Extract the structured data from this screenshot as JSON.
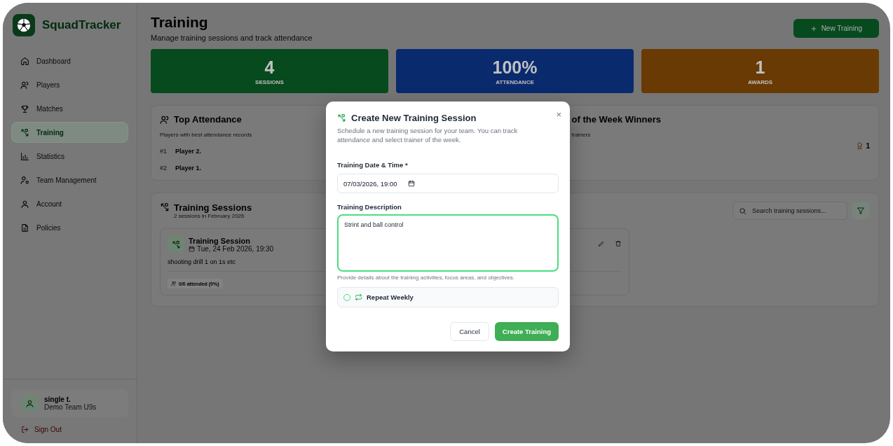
{
  "brand": {
    "name": "SquadTracker"
  },
  "nav": [
    {
      "label": "Dashboard",
      "selected": false
    },
    {
      "label": "Players",
      "selected": false
    },
    {
      "label": "Matches",
      "selected": false
    },
    {
      "label": "Training",
      "selected": true
    },
    {
      "label": "Statistics",
      "selected": false
    },
    {
      "label": "Team Management",
      "selected": false
    },
    {
      "label": "Account",
      "selected": false
    },
    {
      "label": "Policies",
      "selected": false
    }
  ],
  "user": {
    "name": "single t.",
    "team": "Demo Team U9s"
  },
  "sign_out": "Sign Out",
  "page": {
    "title": "Training",
    "subtitle": "Manage training sessions and track attendance",
    "new_button": "New Training"
  },
  "stats": [
    {
      "value": "4",
      "label": "SESSIONS",
      "color": "#064a1e"
    },
    {
      "value": "100%",
      "label": "ATTENDANCE",
      "color": "#0a2a6e"
    },
    {
      "value": "1",
      "label": "AWARDS",
      "color": "#6a3a04"
    }
  ],
  "top_attendance": {
    "title": "Top Attendance",
    "subtitle": "Players with best attendance records",
    "rows": [
      {
        "rank": "#1",
        "name": "Player 2."
      },
      {
        "rank": "#2",
        "name": "Player 1."
      }
    ]
  },
  "trainer_winners": {
    "title": "of the Week Winners",
    "subtitle": "trainers",
    "award_count": "1"
  },
  "sessions": {
    "title": "Training Sessions",
    "subtitle": "2 sessions in February 2026",
    "search_placeholder": "Search training sessions...",
    "items": [
      {
        "title": "Training Session",
        "date": "Tue, 24 Feb 2026, 19:30",
        "description": "shooting drill 1 on 1s etc",
        "attendance": "0/0 attended (0%)"
      }
    ]
  },
  "dialog": {
    "title": "Create New Training Session",
    "description": "Schedule a new training session for your team. You can track attendance and select trainer of the week.",
    "date_label": "Training Date & Time *",
    "date_value": "07/03/2026, 19:00",
    "description_label": "Training Description",
    "description_value": "Strint and ball control",
    "description_hint": "Provide details about the training activities, focus areas, and objectives.",
    "repeat_weekly": {
      "label": "Repeat Weekly",
      "checked": false
    },
    "cancel": "Cancel",
    "submit": "Create Training",
    "close": "×"
  }
}
